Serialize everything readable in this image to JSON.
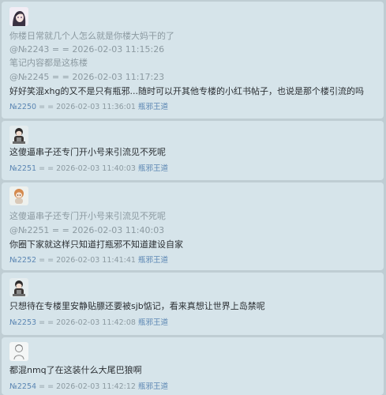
{
  "posts": [
    {
      "avatar_icon": "anime-girl-avatar-icon",
      "quote_lines": [
        "你楼日常就几个人怎么就是你楼大妈干的了",
        "@№2243 = = 2026-02-03 11:15:26",
        "笔记内容都是这栋楼",
        "@№2245 = = 2026-02-03 11:17:23"
      ],
      "body_lines": [
        "好好笑混xhg的又不是只有瓶邪...随时可以开其他专楼的小红书帖子，也说是那个楼引流的吗"
      ],
      "meta": {
        "no": "№2250",
        "sep": "= =",
        "time": "2026-02-03 11:36:01",
        "name": "瓶邪王道"
      }
    },
    {
      "avatar_icon": "chibi-figure-avatar-icon",
      "quote_lines": [],
      "body_lines": [
        "这傻逼串子还专门开小号来引流见不死呢"
      ],
      "meta": {
        "no": "№2251",
        "sep": "= =",
        "time": "2026-02-03 11:40:03",
        "name": "瓶邪王道"
      }
    },
    {
      "avatar_icon": "chibi-orange-hair-avatar-icon",
      "quote_lines": [
        "这傻逼串子还专门开小号来引流见不死呢",
        "@№2251 = = 2026-02-03 11:40:03"
      ],
      "body_lines": [
        "你圈下家就这样只知道打瓶邪不知道建设自家"
      ],
      "meta": {
        "no": "№2252",
        "sep": "= =",
        "time": "2026-02-03 11:41:41",
        "name": "瓶邪王道"
      }
    },
    {
      "avatar_icon": "chibi-figure-avatar-icon",
      "quote_lines": [],
      "body_lines": [
        "只想待在专楼里安静贴膘还要被sjb惦记，看来真想让世界上岛禁呢"
      ],
      "meta": {
        "no": "№2253",
        "sep": "= =",
        "time": "2026-02-03 11:42:08",
        "name": "瓶邪王道"
      }
    },
    {
      "avatar_icon": "sketch-figure-avatar-icon",
      "quote_lines": [],
      "body_lines": [
        "都混nmq了在这装什么大尾巴狼啊"
      ],
      "meta": {
        "no": "№2254",
        "sep": "= =",
        "time": "2026-02-03 11:42:12",
        "name": "瓶邪王道"
      }
    }
  ]
}
